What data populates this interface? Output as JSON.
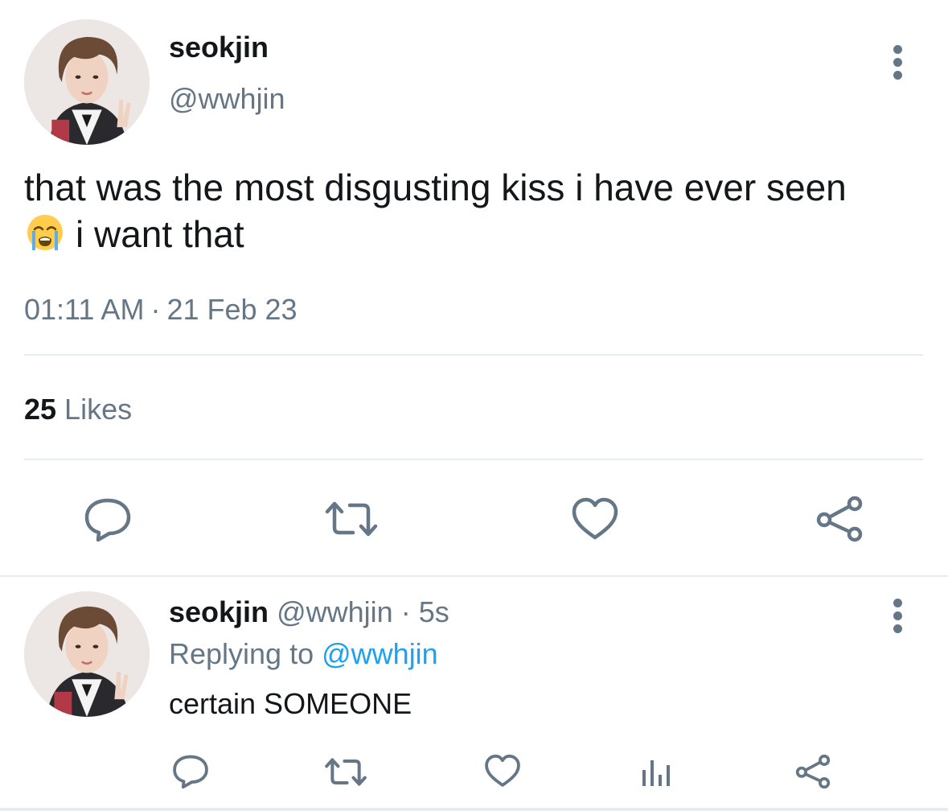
{
  "main_tweet": {
    "display_name": "seokjin",
    "handle": "@wwhjin",
    "text_line1": "that was the most disgusting kiss i have ever seen",
    "text_line2": "i want that",
    "emoji": "loudly-crying-face",
    "time": "01:11 AM",
    "separator": "·",
    "date": "21 Feb 23",
    "likes_count": "25",
    "likes_label": "Likes"
  },
  "reply_tweet": {
    "display_name": "seokjin",
    "handle": "@wwhjin",
    "separator": "·",
    "age": "5s",
    "replying_prefix": "Replying to",
    "replying_to": "@wwhjin",
    "text": "certain SOMEONE"
  },
  "icons": {
    "reply": "reply-icon",
    "retweet": "retweet-icon",
    "like": "heart-icon",
    "share": "share-icon",
    "analytics": "analytics-icon",
    "more": "more-vertical-icon"
  },
  "colors": {
    "text_primary": "#14171a",
    "text_secondary": "#657786",
    "link": "#1da1f2",
    "divider": "#e6ecf0"
  }
}
